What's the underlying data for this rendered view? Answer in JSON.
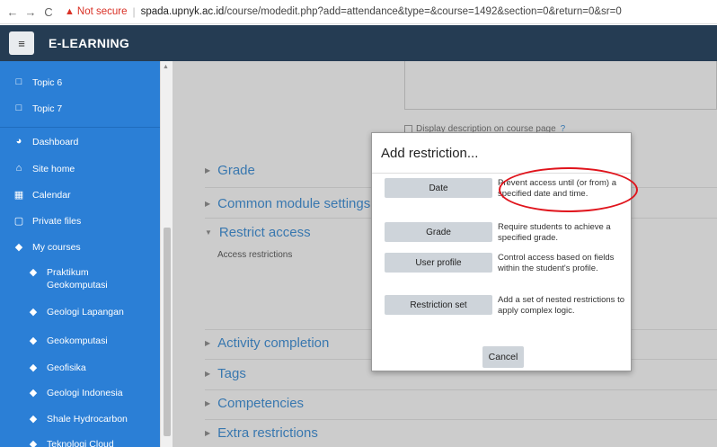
{
  "browser": {
    "back": "←",
    "forward": "→",
    "reload": "C",
    "warning_icon": "▲",
    "not_secure": "Not secure",
    "separator": "|",
    "url_host": "spada.upnyk.ac.id",
    "url_path": "/course/modedit.php?add=attendance&type=&course=1492&section=0&return=0&sr=0"
  },
  "navbar": {
    "menu_icon": "≡",
    "brand": "E-LEARNING"
  },
  "sidebar": {
    "items": [
      {
        "icon": "folder-icon",
        "glyph": "□",
        "label": "Topic 6"
      },
      {
        "icon": "folder-icon",
        "glyph": "□",
        "label": "Topic 7"
      },
      {
        "icon": "dashboard-icon",
        "glyph": "◕",
        "label": "Dashboard"
      },
      {
        "icon": "home-icon",
        "glyph": "⌂",
        "label": "Site home"
      },
      {
        "icon": "calendar-icon",
        "glyph": "▦",
        "label": "Calendar"
      },
      {
        "icon": "file-icon",
        "glyph": "▢",
        "label": "Private files"
      },
      {
        "icon": "graduation-cap-icon",
        "glyph": "◆",
        "label": "My courses"
      },
      {
        "icon": "graduation-cap-icon",
        "glyph": "◆",
        "label": "Praktikum\nGeokomputasi"
      },
      {
        "icon": "graduation-cap-icon",
        "glyph": "◆",
        "label": "Geologi Lapangan"
      },
      {
        "icon": "graduation-cap-icon",
        "glyph": "◆",
        "label": "Geokomputasi"
      },
      {
        "icon": "graduation-cap-icon",
        "glyph": "◆",
        "label": "Geofisika"
      },
      {
        "icon": "graduation-cap-icon",
        "glyph": "◆",
        "label": "Geologi Indonesia"
      },
      {
        "icon": "graduation-cap-icon",
        "glyph": "◆",
        "label": "Shale Hydrocarbon"
      },
      {
        "icon": "graduation-cap-icon",
        "glyph": "◆",
        "label": "Teknologi Cloud"
      }
    ]
  },
  "main": {
    "display_description": "Display description on course page",
    "help_icon": "?",
    "sections": [
      {
        "label": "Grade"
      },
      {
        "label": "Common module settings"
      },
      {
        "label": "Restrict access"
      },
      {
        "label": "Activity completion"
      },
      {
        "label": "Tags"
      },
      {
        "label": "Competencies"
      },
      {
        "label": "Extra restrictions"
      }
    ],
    "access_restrictions": "Access restrictions"
  },
  "modal": {
    "title": "Add restriction...",
    "options": [
      {
        "button": "Date",
        "description": "Prevent access until (or from) a specified date and time."
      },
      {
        "button": "Grade",
        "description": "Require students to achieve a specified grade."
      },
      {
        "button": "User profile",
        "description": "Control access based on fields within the student's profile."
      },
      {
        "button": "Restriction set",
        "description": "Add a set of nested restrictions to apply complex logic."
      }
    ],
    "cancel": "Cancel"
  },
  "colors": {
    "navbar": "#253c53",
    "sidebar": "#2b7fd6",
    "link": "#1177d1",
    "annotation": "#e0141c"
  }
}
